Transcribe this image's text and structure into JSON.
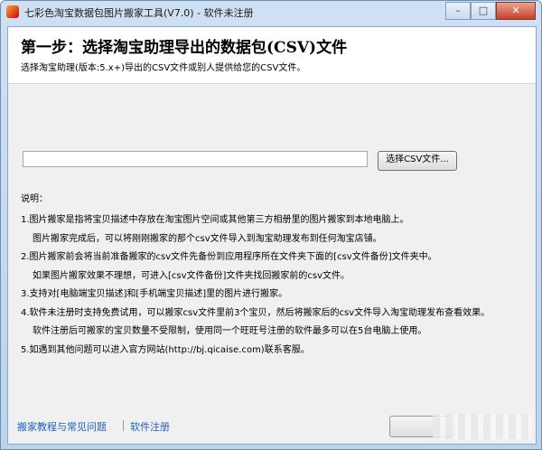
{
  "window": {
    "title": "七彩色淘宝数据包图片搬家工具(V7.0) - 软件未注册",
    "min_label": "–",
    "max_label": "□",
    "close_label": "✕"
  },
  "header": {
    "title": "第一步：选择淘宝助理导出的数据包(CSV)文件",
    "subtitle": "选择淘宝助理(版本:5.x+)导出的CSV文件或别人提供给您的CSV文件。"
  },
  "file_picker": {
    "path_value": "",
    "browse_label": "选择CSV文件..."
  },
  "notes": {
    "heading": "说明：",
    "lines": [
      "1.图片搬家是指将宝贝描述中存放在淘宝图片空间或其他第三方相册里的图片搬家到本地电脑上。",
      "图片搬家完成后，可以将刚刚搬家的那个csv文件导入到淘宝助理发布到任何淘宝店铺。",
      "2.图片搬家前会将当前准备搬家的csv文件先备份到应用程序所在文件夹下面的[csv文件备份]文件夹中。",
      "如果图片搬家效果不理想，可进入[csv文件备份]文件夹找回搬家前的csv文件。",
      "3.支持对[电脑端宝贝描述]和[手机端宝贝描述]里的图片进行搬家。",
      "4.软件未注册时支持免费试用，可以搬家csv文件里前3个宝贝，然后将搬家后的csv文件导入淘宝助理发布查看效果。",
      "软件注册后可搬家的宝贝数量不受限制，使用同一个旺旺号注册的软件最多可以在5台电脑上使用。",
      "5.如遇到其他问题可以进入官方网站(http://bj.qicaise.com)联系客服。"
    ]
  },
  "footer": {
    "tutorial_link": "搬家教程与常见问题",
    "register_link": "软件注册",
    "link_color": "#1f5fbf"
  }
}
